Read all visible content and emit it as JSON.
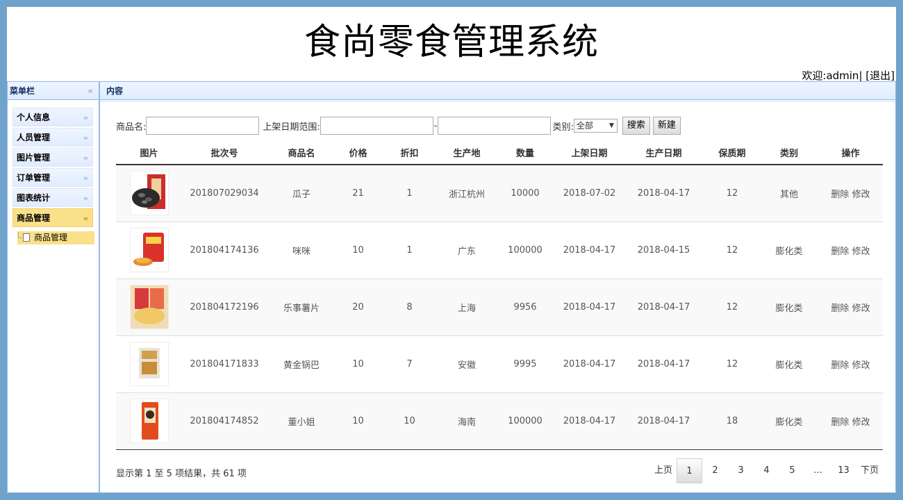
{
  "header": {
    "title": "食尚零食管理系统",
    "welcome": "欢迎:admin|",
    "logout": "[退出]"
  },
  "sidebar": {
    "title": "菜单栏",
    "collapse_icon": "double-chevron-left-icon",
    "items": [
      {
        "label": "个人信息",
        "active": false
      },
      {
        "label": "人员管理",
        "active": false
      },
      {
        "label": "图片管理",
        "active": false
      },
      {
        "label": "订单管理",
        "active": false
      },
      {
        "label": "图表统计",
        "active": false
      },
      {
        "label": "商品管理",
        "active": true
      }
    ],
    "subitem": "商品管理"
  },
  "content": {
    "title": "内容",
    "search": {
      "name_label": "商品名:",
      "name_value": "",
      "date_label": "上架日期范围:",
      "date_start": "",
      "date_sep": "-",
      "date_end": "",
      "category_label": "类别:",
      "category_value": "全部",
      "search_button": "搜索",
      "new_button": "新建"
    },
    "table": {
      "headers": [
        "图片",
        "批次号",
        "商品名",
        "价格",
        "折扣",
        "生产地",
        "数量",
        "上架日期",
        "生产日期",
        "保质期",
        "类别",
        "操作"
      ],
      "rows": [
        {
          "image": "sunflower-seeds-image",
          "batch": "201807029034",
          "name": "瓜子",
          "price": "21",
          "discount": "1",
          "origin": "浙江杭州",
          "quantity": "10000",
          "listed": "2018-07-02",
          "produced": "2018-04-17",
          "shelf_life": "12",
          "category": "其他",
          "delete": "删除",
          "edit": "修改"
        },
        {
          "image": "mimi-snack-image",
          "batch": "201804174136",
          "name": "咪咪",
          "price": "10",
          "discount": "1",
          "origin": "广东",
          "quantity": "100000",
          "listed": "2018-04-17",
          "produced": "2018-04-15",
          "shelf_life": "12",
          "category": "膨化类",
          "delete": "删除",
          "edit": "修改"
        },
        {
          "image": "lays-chips-image",
          "batch": "201804172196",
          "name": "乐事薯片",
          "price": "20",
          "discount": "8",
          "origin": "上海",
          "quantity": "9956",
          "listed": "2018-04-17",
          "produced": "2018-04-17",
          "shelf_life": "12",
          "category": "膨化类",
          "delete": "删除",
          "edit": "修改"
        },
        {
          "image": "golden-crust-image",
          "batch": "201804171833",
          "name": "黄金锅巴",
          "price": "10",
          "discount": "7",
          "origin": "安徽",
          "quantity": "9995",
          "listed": "2018-04-17",
          "produced": "2018-04-17",
          "shelf_life": "12",
          "category": "膨化类",
          "delete": "删除",
          "edit": "修改"
        },
        {
          "image": "dong-xiaojie-image",
          "batch": "201804174852",
          "name": "董小姐",
          "price": "10",
          "discount": "10",
          "origin": "海南",
          "quantity": "100000",
          "listed": "2018-04-17",
          "produced": "2018-04-17",
          "shelf_life": "18",
          "category": "膨化类",
          "delete": "删除",
          "edit": "修改"
        }
      ]
    },
    "summary": "显示第 1 至 5 项结果，共 61 项",
    "pager": {
      "prev": "上页",
      "pages": [
        "1",
        "2",
        "3",
        "4",
        "5",
        "…",
        "13"
      ],
      "current": "1",
      "next": "下页"
    }
  },
  "colors": {
    "page_border": "#6fa3cc",
    "panel_border": "#95b8e7",
    "active_menu": "#fbe08a"
  }
}
